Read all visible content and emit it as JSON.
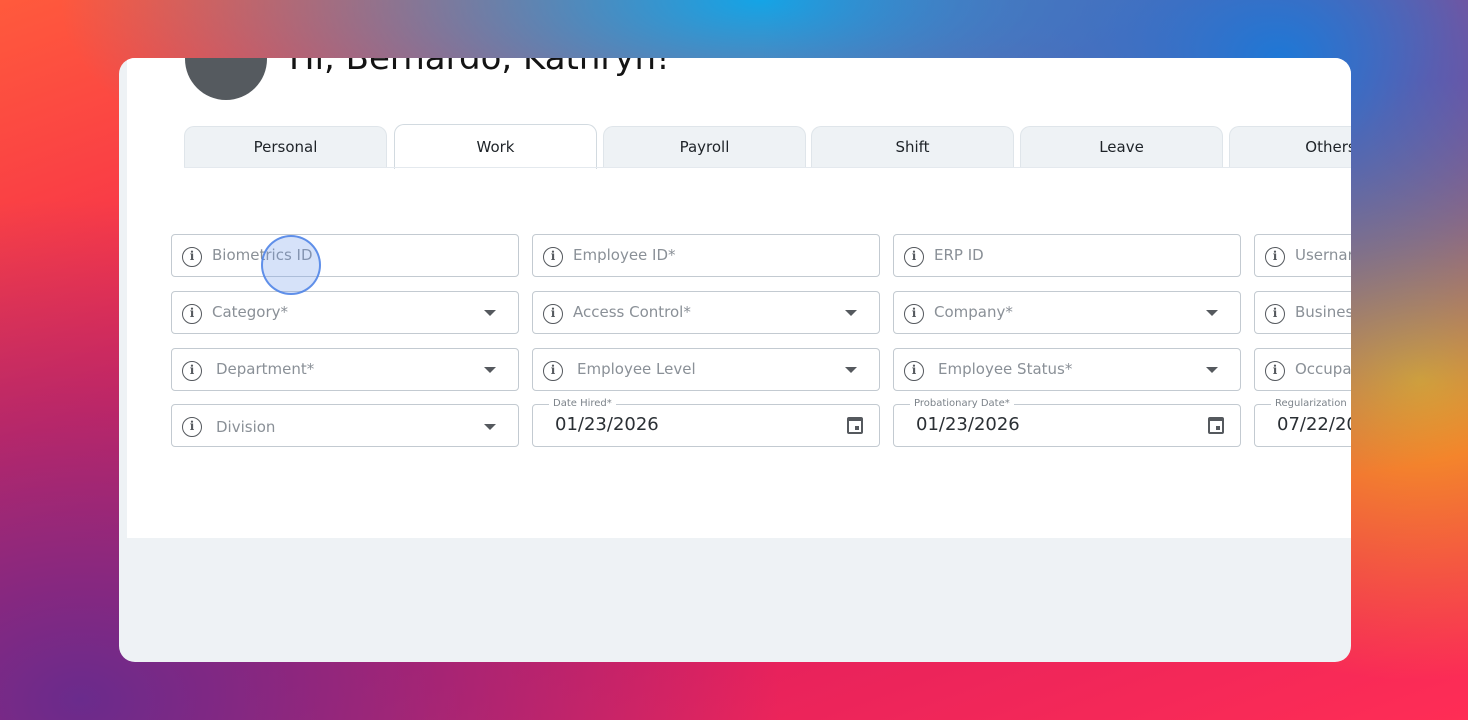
{
  "header": {
    "greeting": "Hi, Bernardo, Kathryn!"
  },
  "tabs": [
    {
      "label": "Personal",
      "active": false
    },
    {
      "label": "Work",
      "active": true
    },
    {
      "label": "Payroll",
      "active": false
    },
    {
      "label": "Shift",
      "active": false
    },
    {
      "label": "Leave",
      "active": false
    },
    {
      "label": "Others",
      "active": false
    }
  ],
  "form": {
    "row1": {
      "biometrics_id": {
        "placeholder": "Biometrics ID",
        "icon": "info-icon"
      },
      "employee_id": {
        "placeholder": "Employee ID*",
        "icon": "info-icon"
      },
      "erp_id": {
        "placeholder": "ERP ID",
        "icon": "info-icon"
      },
      "username": {
        "placeholder": "Usernar",
        "icon": "info-icon"
      }
    },
    "row2": {
      "category": {
        "placeholder": "Category*",
        "icon": "info-icon"
      },
      "access_control": {
        "placeholder": "Access Control*",
        "icon": "info-icon"
      },
      "company": {
        "placeholder": "Company*",
        "icon": "info-icon"
      },
      "business": {
        "placeholder": "Busines",
        "icon": "info-icon"
      }
    },
    "row3": {
      "department": {
        "placeholder": "Department*",
        "icon": "info-icon"
      },
      "employee_level": {
        "placeholder": "Employee Level",
        "icon": "info-icon"
      },
      "employee_status": {
        "placeholder": "Employee Status*",
        "icon": "info-icon"
      },
      "occupation": {
        "placeholder": "Occupa",
        "icon": "info-icon"
      }
    },
    "row4": {
      "division": {
        "placeholder": "Division",
        "icon": "info-icon"
      },
      "date_hired": {
        "label": "Date Hired*",
        "value": "01/23/2026",
        "icon": "calendar-icon"
      },
      "probationary_date": {
        "label": "Probationary Date*",
        "value": "01/23/2026",
        "icon": "calendar-icon"
      },
      "regularization_date": {
        "label": "Regularization",
        "value": "07/22/20"
      }
    }
  },
  "colors": {
    "window_bg": "#eef2f5",
    "panel_bg": "#ffffff",
    "field_border": "#c3cad1",
    "cursor_ring": "#4a80e6"
  }
}
